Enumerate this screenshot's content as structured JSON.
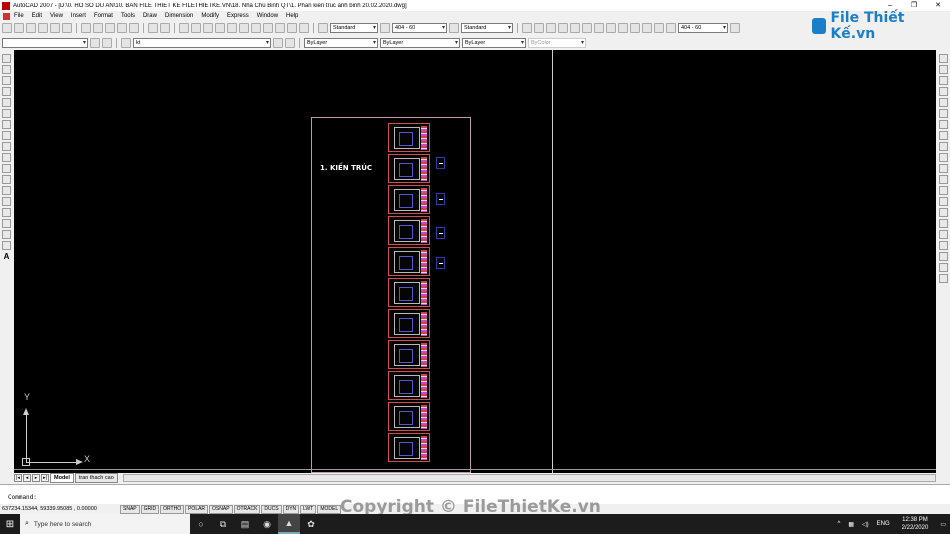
{
  "window": {
    "title": "AutoCAD 2007 - [D:\\0. HO SO DU AN\\10. BAN FILE THIET KE FILETHIETKE.VN\\18. Nha Chu Binh QT\\1. Phan kien truc anh binh 20.02.2020.dwg]",
    "controls": [
      "–",
      "❐",
      "✕"
    ]
  },
  "menu": [
    "File",
    "Edit",
    "View",
    "Insert",
    "Format",
    "Tools",
    "Draw",
    "Dimension",
    "Modify",
    "Express",
    "Window",
    "Help"
  ],
  "logo": {
    "text": "File Thiết Kế.vn",
    "color": "#1a7ec8"
  },
  "toolbar1": {
    "text_style": "Standard",
    "dim_style": "404 - 60",
    "table_style": "Standard",
    "multileader_style": "404 - 60"
  },
  "toolbar2": {
    "workspace": "",
    "layer": "kt",
    "color": "ByLayer",
    "linetype": "ByLayer",
    "lineweight": "ByLayer",
    "plotstyle": "ByColor"
  },
  "drawing": {
    "section_label": "1. KIẾN TRÚC",
    "sheet_count": 11,
    "ucs": {
      "x_label": "X",
      "y_label": "Y"
    }
  },
  "layout_tabs": {
    "nav": [
      "|◂",
      "◂",
      "▸",
      "▸|"
    ],
    "tabs": [
      "Model",
      "tran thach cao"
    ],
    "active": "Model"
  },
  "command": {
    "prompt": "Command:"
  },
  "status": {
    "coordinates": "637234.15344, 59339.95085 , 0.00000",
    "toggles": [
      "SNAP",
      "GRID",
      "ORTHO",
      "POLAR",
      "OSNAP",
      "OTRACK",
      "DUCS",
      "DYN",
      "LWT",
      "MODEL"
    ]
  },
  "watermark": "Copyright © FileThietKe.vn",
  "taskbar": {
    "search_placeholder": "Type here to search",
    "lang": "ENG",
    "time": "12:38 PM",
    "date": "2/22/2020"
  }
}
